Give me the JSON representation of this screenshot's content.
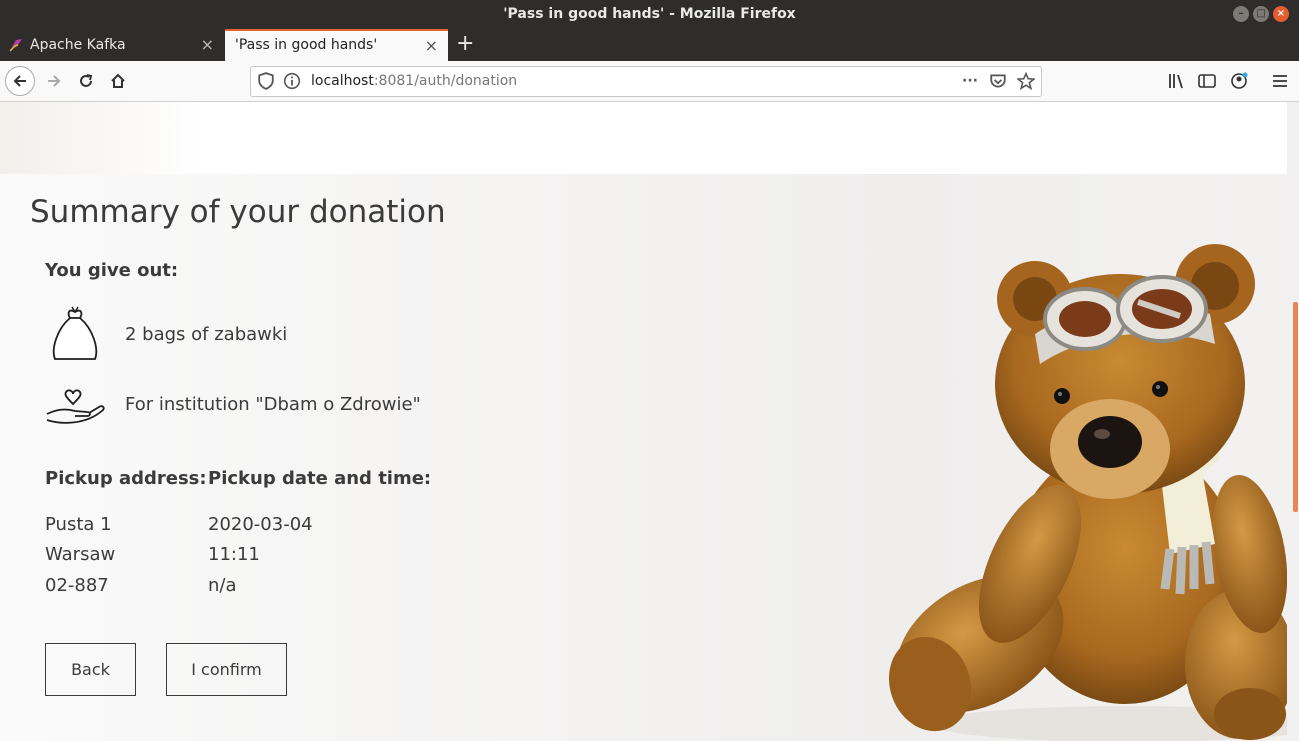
{
  "window": {
    "title": "'Pass in good hands' - Mozilla Firefox"
  },
  "tabs": [
    {
      "label": "Apache Kafka",
      "close": "×"
    },
    {
      "label": "'Pass in good hands'",
      "close": "×"
    }
  ],
  "newtab": "+",
  "url": {
    "host": "localhost",
    "rest": ":8081/auth/donation"
  },
  "summary": {
    "title": "Summary of your donation",
    "subtitle": "You give out:",
    "bags_text": "2 bags of zabawki",
    "institution_text": "For institution \"Dbam o Zdrowie\"",
    "pickup_address_title": "Pickup address:",
    "pickup_date_title": "Pickup date and time:",
    "address": [
      "Pusta 1",
      "Warsaw",
      "02-887"
    ],
    "datetime": [
      "2020-03-04",
      "11:11",
      "n/a"
    ],
    "back_label": "Back",
    "confirm_label": "I confirm"
  },
  "colors": {
    "accent": "#e4642d",
    "text": "#3b3b3b"
  }
}
